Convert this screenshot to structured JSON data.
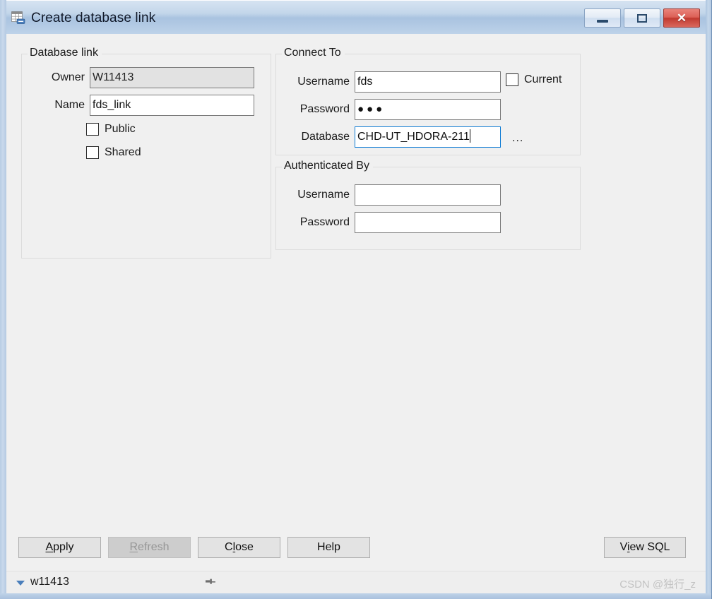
{
  "window": {
    "title": "Create database link",
    "icon": "database-link-icon",
    "buttons": {
      "minimize": "minimize-icon",
      "maximize": "maximize-icon",
      "close": "close-icon",
      "close_glyph": "✕"
    }
  },
  "database_link": {
    "legend": "Database link",
    "owner": {
      "label": "Owner",
      "value": "W11413",
      "readonly": true
    },
    "name": {
      "label": "Name",
      "value": "fds_link",
      "placeholder": ""
    },
    "public": {
      "label": "Public",
      "checked": false
    },
    "shared": {
      "label": "Shared",
      "checked": false
    }
  },
  "connect_to": {
    "legend": "Connect To",
    "username": {
      "label": "Username",
      "value": "fds",
      "placeholder": ""
    },
    "password": {
      "label": "Password",
      "value": "●●●",
      "placeholder": ""
    },
    "database": {
      "label": "Database",
      "value": "CHD-UT_HDORA-211",
      "placeholder": "",
      "focused": true
    },
    "browse": "...",
    "current": {
      "label": "Current",
      "checked": false
    }
  },
  "authenticated_by": {
    "legend": "Authenticated By",
    "username": {
      "label": "Username",
      "value": "",
      "placeholder": ""
    },
    "password": {
      "label": "Password",
      "value": "",
      "placeholder": ""
    }
  },
  "footer": {
    "apply": {
      "label": "Apply",
      "accel": "A",
      "disabled": false
    },
    "refresh": {
      "label": "Refresh",
      "accel": "R",
      "disabled": true
    },
    "close": {
      "label": "Close",
      "accel": "l",
      "disabled": false
    },
    "help": {
      "label": "Help",
      "accel": "",
      "disabled": false
    },
    "view_sql": {
      "label": "View SQL",
      "accel": "i",
      "disabled": false
    }
  },
  "statusbar": {
    "connection": "w11413",
    "dropdown_icon": "chevron-down-icon",
    "pin_icon": "pin-icon",
    "watermark": "CSDN @独行_z"
  },
  "colors": {
    "accent": "#0f7bd4",
    "titlebar": "#c3d6ea",
    "close_button": "#c0392f",
    "background": "#f0f0f0",
    "field_readonly": "#e2e2e2"
  }
}
